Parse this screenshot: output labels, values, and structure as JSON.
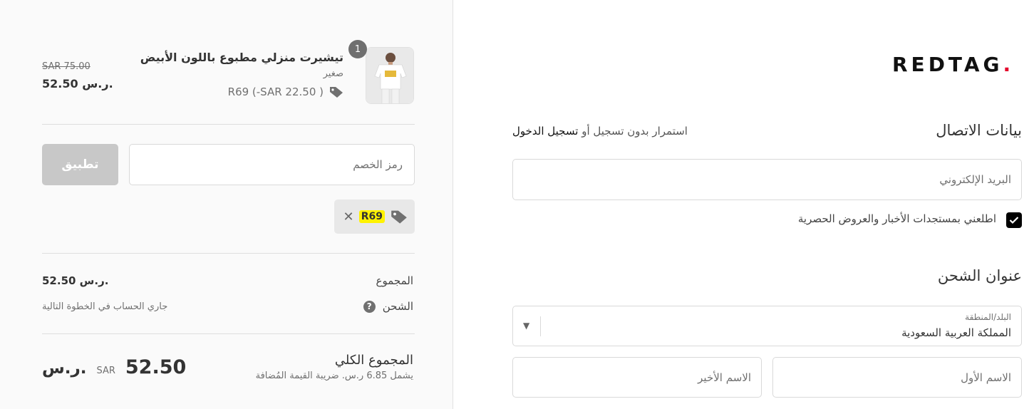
{
  "summary": {
    "item": {
      "quantity": "1",
      "title": "تيشيرت منزلي مطبوع باللون الأبيض",
      "size": "صغير",
      "discount": "R69 (-SAR 22.50 )",
      "old_price": "SAR 75.00",
      "price": "52.50 ر.س."
    },
    "discount_code": {
      "placeholder": "رمز الخصم",
      "apply_label": "تطبيق",
      "applied_code": "R69",
      "remove_icon": "close-icon"
    },
    "subtotal": {
      "label": "المجموع",
      "value": "52.50 ر.س."
    },
    "shipping": {
      "label": "الشحن",
      "value": "جاري الحساب في الخطوة التالية"
    },
    "total": {
      "label": "المجموع الكلي",
      "tax_note": "يشمل 6.85 ر.س. ضريبة القيمة المُضافة",
      "currency_code": "SAR",
      "amount": "52.50",
      "currency_ar": "ر.س."
    }
  },
  "form": {
    "logo": {
      "text": "REDTAG",
      "dot": ".",
      "dot_color": "#e4002b"
    },
    "contact": {
      "title": "بيانات الاتصال",
      "hint_text": "استمرار بدون تسجيل أو ",
      "login_link": "تسجيل الدخول",
      "email_placeholder": "البريد الإلكتروني",
      "newsletter_label": "اطلعني بمستجدات الأخبار والعروض الحصرية",
      "newsletter_checked": true
    },
    "shipping": {
      "title": "عنوان الشحن",
      "country_label": "البلد/المنطقة",
      "country_value": "المملكة العربية السعودية",
      "first_name_placeholder": "الاسم الأول",
      "last_name_placeholder": "الاسم الأخير"
    }
  },
  "colors": {
    "highlight": "#fff200",
    "apply_disabled": "#c8c8c8",
    "panel_bg": "#fafafa"
  }
}
